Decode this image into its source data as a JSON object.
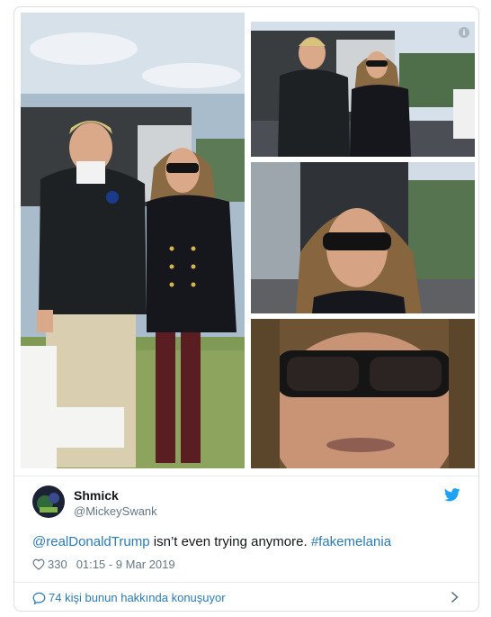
{
  "tweet": {
    "author_name": "Shmick",
    "author_handle": "@MickeySwank",
    "mention": "@realDonaldTrump",
    "body": " isn’t even trying anymore. ",
    "hashtag": "#fakemelania",
    "likes": "330",
    "timestamp": "01:15 - 9 Mar 2019"
  },
  "footer": {
    "conversation_label": "74 kişi bunun hakkında konuşuyor"
  },
  "media": {
    "info_icon": "i"
  },
  "colors": {
    "link": "#2b7bb9",
    "twitter_blue": "#1da1f2",
    "muted": "#657786",
    "text": "#14171a",
    "border": "#d9dfe4"
  },
  "icons": [
    "info-icon",
    "twitter-bird-icon",
    "heart-icon",
    "reply-bubble-icon",
    "chevron-right-icon"
  ]
}
